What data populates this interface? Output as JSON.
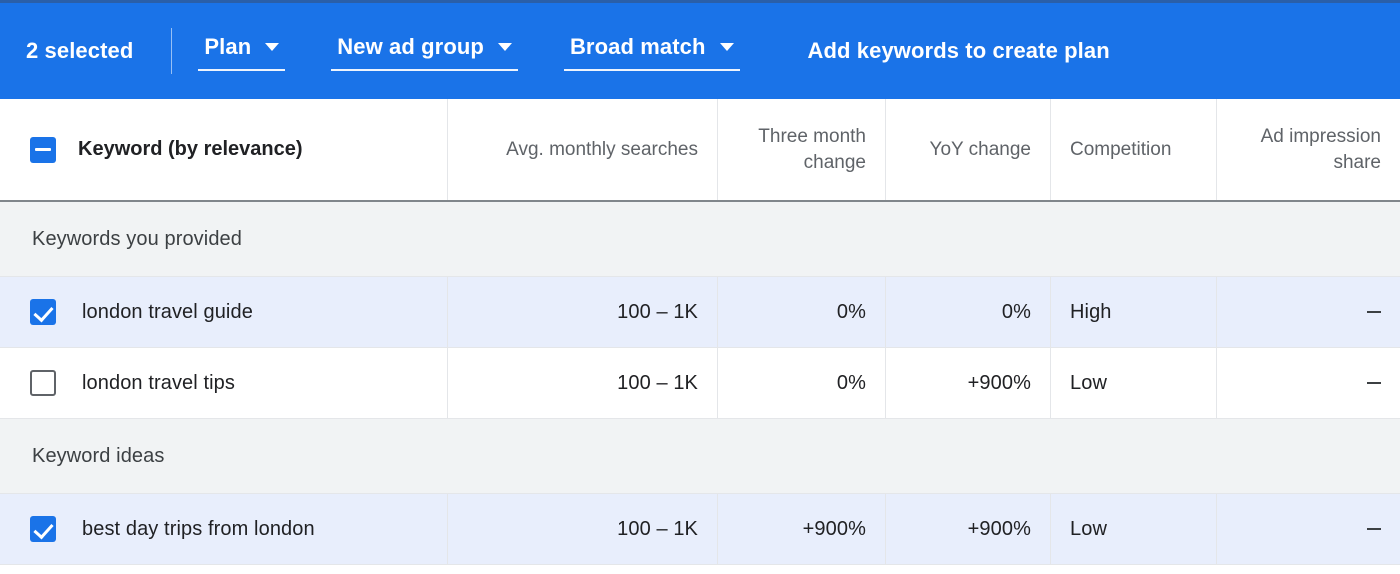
{
  "toolbar": {
    "selected_label": "2 selected",
    "dropdowns": [
      {
        "label": "Plan",
        "icon": "chevron-down-icon"
      },
      {
        "label": "New ad group",
        "icon": "chevron-down-icon"
      },
      {
        "label": "Broad match",
        "icon": "chevron-down-icon"
      }
    ],
    "action_label": "Add keywords to create plan",
    "background_color": "#1a73e8"
  },
  "table": {
    "header_checkbox_state": "indeterminate",
    "columns": [
      {
        "key": "keyword",
        "label": "Keyword (by relevance)",
        "align": "left"
      },
      {
        "key": "avg_monthly_searches",
        "label": "Avg. monthly searches",
        "align": "right"
      },
      {
        "key": "three_month_change",
        "label": "Three month change",
        "align": "right"
      },
      {
        "key": "yoy_change",
        "label": "YoY change",
        "align": "right"
      },
      {
        "key": "competition",
        "label": "Competition",
        "align": "left"
      },
      {
        "key": "ad_impression_share",
        "label": "Ad impression share",
        "align": "right"
      }
    ],
    "groups": [
      {
        "label": "Keywords you provided",
        "rows": [
          {
            "checked": true,
            "keyword": "london travel guide",
            "avg_monthly_searches": "100 – 1K",
            "three_month_change": "0%",
            "yoy_change": "0%",
            "competition": "High",
            "ad_impression_share": "—"
          },
          {
            "checked": false,
            "keyword": "london travel tips",
            "avg_monthly_searches": "100 – 1K",
            "three_month_change": "0%",
            "yoy_change": "+900%",
            "competition": "Low",
            "ad_impression_share": "—"
          }
        ]
      },
      {
        "label": "Keyword ideas",
        "rows": [
          {
            "checked": true,
            "keyword": "best day trips from london",
            "avg_monthly_searches": "100 – 1K",
            "three_month_change": "+900%",
            "yoy_change": "+900%",
            "competition": "Low",
            "ad_impression_share": "—"
          }
        ]
      }
    ]
  },
  "colors": {
    "accent": "#1a73e8",
    "selected_row": "#e8eefc",
    "group_header": "#f1f3f4",
    "border": "#e4e6e9",
    "header_rule": "#80868b",
    "text_primary": "#202124",
    "text_secondary": "#5f6368"
  }
}
